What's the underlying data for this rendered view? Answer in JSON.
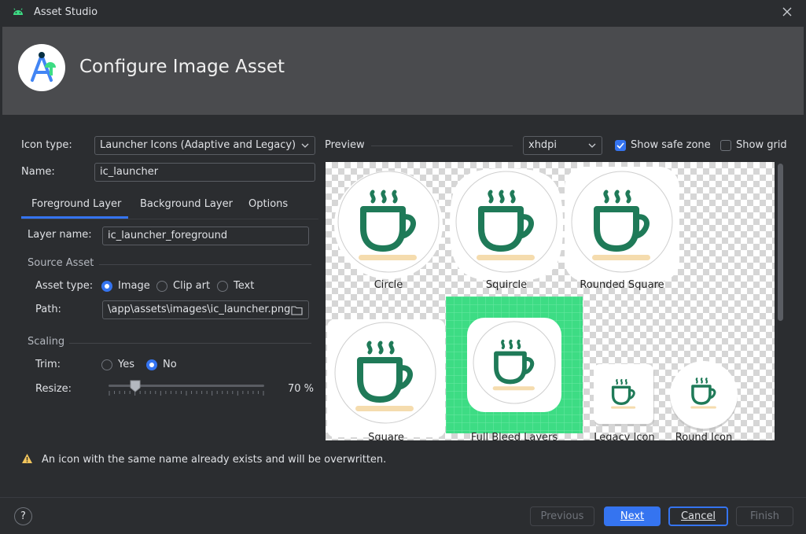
{
  "window": {
    "title": "Asset Studio"
  },
  "header": {
    "title": "Configure Image Asset"
  },
  "form": {
    "icon_type_label": "Icon type:",
    "icon_type_value": "Launcher Icons (Adaptive and Legacy)",
    "name_label": "Name:",
    "name_value": "ic_launcher"
  },
  "tabs": [
    {
      "label": "Foreground Layer",
      "selected": true
    },
    {
      "label": "Background Layer",
      "selected": false
    },
    {
      "label": "Options",
      "selected": false
    }
  ],
  "foreground": {
    "layer_name_label": "Layer name:",
    "layer_name_value": "ic_launcher_foreground",
    "source_asset_title": "Source Asset",
    "asset_type_label": "Asset type:",
    "asset_type_options": [
      "Image",
      "Clip art",
      "Text"
    ],
    "asset_type_selected": "Image",
    "path_label": "Path:",
    "path_value": "\\app\\assets\\images\\ic_launcher.png",
    "scaling_title": "Scaling",
    "trim_label": "Trim:",
    "trim_options": [
      "Yes",
      "No"
    ],
    "trim_selected": "No",
    "resize_label": "Resize:",
    "resize_value": "70 %",
    "resize_fraction": 0.17
  },
  "preview": {
    "label": "Preview",
    "density_value": "xhdpi",
    "show_safe_zone_label": "Show safe zone",
    "show_safe_zone_checked": true,
    "show_grid_label": "Show grid",
    "show_grid_checked": false,
    "icons": [
      {
        "caption": "Circle"
      },
      {
        "caption": "Squircle"
      },
      {
        "caption": "Rounded Square"
      },
      {
        "caption": "Square"
      },
      {
        "caption": "Full Bleed Layers"
      },
      {
        "caption": "Legacy Icon"
      },
      {
        "caption": "Round Icon"
      }
    ]
  },
  "warning": {
    "text": "An icon with the same name already exists and will be overwritten."
  },
  "footer": {
    "help_label": "?",
    "previous_label": "Previous",
    "next_label": "Next",
    "cancel_label": "Cancel",
    "finish_label": "Finish"
  },
  "colors": {
    "accent": "#3574f0",
    "cup_green": "#1f7a58",
    "saucer": "#f5dcae",
    "full_bleed_bg": "#3ddc84"
  }
}
